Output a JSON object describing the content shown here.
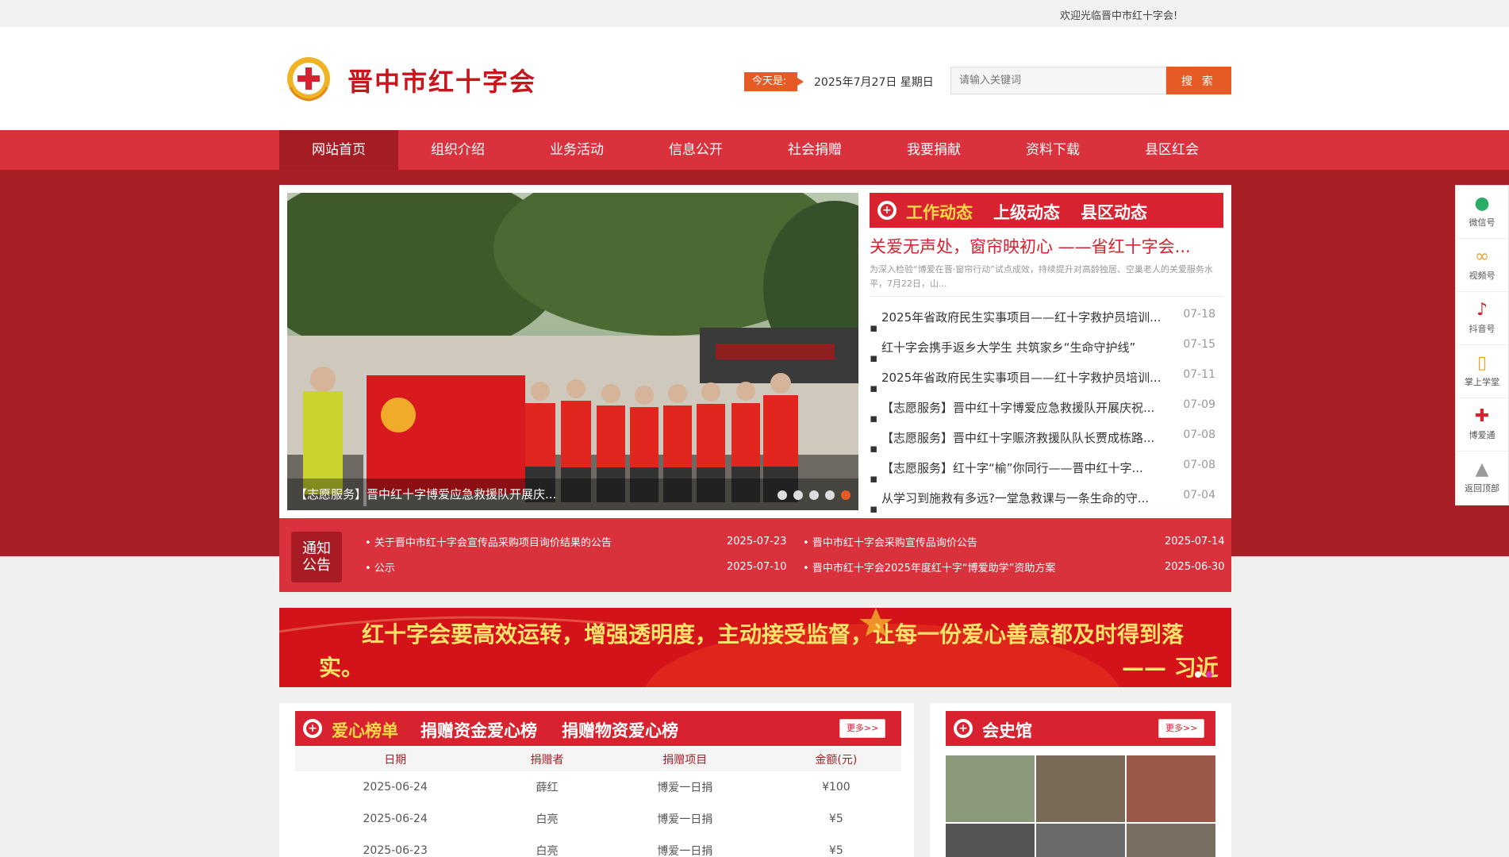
{
  "topbar": {
    "welcome": "欢迎光临晋中市红十字会!"
  },
  "header": {
    "site_title": "晋中市红十字会",
    "today_label": "今天是:",
    "today_date": "2025年7月27日 星期日",
    "search_placeholder": "请输入关键词",
    "search_button": "搜 索"
  },
  "nav": {
    "items": [
      "网站首页",
      "组织介绍",
      "业务活动",
      "信息公开",
      "社会捐赠",
      "我要捐献",
      "资料下载",
      "县区红会"
    ],
    "active_index": 0
  },
  "slider": {
    "caption": "【志愿服务】晋中红十字博爱应急救援队开展庆...",
    "dot_count": 5,
    "active_dot": 5
  },
  "news": {
    "tabs": [
      "工作动态",
      "上级动态",
      "县区动态"
    ],
    "active_tab": 0,
    "headline": "关爱无声处，窗帘映初心 ——省红十字会...",
    "summary": "为深入检验“博爱在晋·窗帘行动”试点成效，持续提升对高龄独居、空巢老人的关爱服务水平，7月22日，山...",
    "items": [
      {
        "title": "2025年省政府民生实事项目——红十字救护员培训...",
        "date": "07-18"
      },
      {
        "title": "红十字会携手返乡大学生 共筑家乡“生命守护线”",
        "date": "07-15"
      },
      {
        "title": "2025年省政府民生实事项目——红十字救护员培训...",
        "date": "07-11"
      },
      {
        "title": "【志愿服务】晋中红十字博爱应急救援队开展庆祝...",
        "date": "07-09"
      },
      {
        "title": "【志愿服务】晋中红十字赈济救援队队长贾成栋路...",
        "date": "07-08"
      },
      {
        "title": "【志愿服务】红十字“榆”你同行——晋中红十字...",
        "date": "07-08"
      },
      {
        "title": "从学习到施救有多远?一堂急救课与一条生命的守...",
        "date": "07-04"
      }
    ]
  },
  "notice": {
    "badge": "通知公告",
    "badge_line1": "通知",
    "badge_line2": "公告",
    "items": [
      {
        "title": "关于晋中市红十字会宣传品采购项目询价结果的公告",
        "date": "2025-07-23"
      },
      {
        "title": "晋中市红十字会采购宣传品询价公告",
        "date": "2025-07-14"
      },
      {
        "title": "公示",
        "date": "2025-07-10"
      },
      {
        "title": "晋中市红十字会2025年度红十字“博爱助学”资助方案",
        "date": "2025-06-30"
      }
    ]
  },
  "banner": {
    "line1": "红十字会要高效运转，增强透明度，主动接受监督，让每一份爱心善意都及时得到落",
    "line2": "实。",
    "signature": "—— 习近平",
    "dot_count": 2,
    "active_dot": 2
  },
  "donations": {
    "tabs": [
      "爱心榜单",
      "捐赠资金爱心榜",
      "捐赠物资爱心榜"
    ],
    "active_tab": 0,
    "more": "更多>>",
    "columns": [
      "日期",
      "捐赠者",
      "捐赠项目",
      "金额(元)"
    ],
    "rows": [
      [
        "2025-06-24",
        "薛红",
        "博爱一日捐",
        "¥100"
      ],
      [
        "2025-06-24",
        "白亮",
        "博爱一日捐",
        "¥5"
      ],
      [
        "2025-06-23",
        "白亮",
        "博爱一日捐",
        "¥5"
      ]
    ]
  },
  "history": {
    "title": "会史馆",
    "more": "更多>>"
  },
  "sidebar": {
    "items": [
      {
        "label": "微信号",
        "icon": "wechat-icon"
      },
      {
        "label": "视频号",
        "icon": "video-channel-icon"
      },
      {
        "label": "抖音号",
        "icon": "douyin-icon"
      },
      {
        "label": "掌上学堂",
        "icon": "mobile-icon"
      },
      {
        "label": "博爱通",
        "icon": "red-cross-icon"
      },
      {
        "label": "返回顶部",
        "icon": "back-to-top-icon"
      }
    ]
  },
  "colors": {
    "brand_red": "#d9323d",
    "dark_red": "#a81f26",
    "accent_orange": "#e65b25",
    "gold": "#ffd84a"
  }
}
